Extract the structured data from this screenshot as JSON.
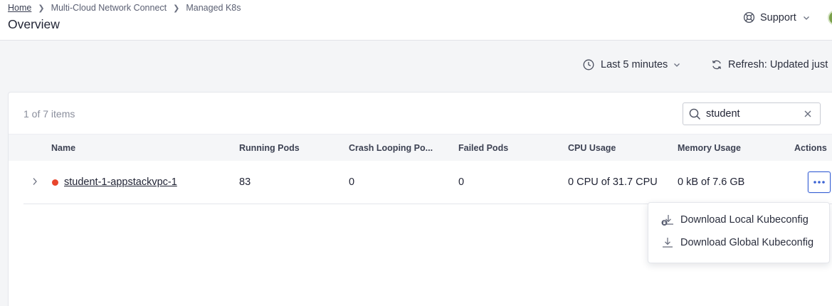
{
  "breadcrumb": {
    "items": [
      "Home",
      "Multi-Cloud Network Connect",
      "Managed K8s"
    ]
  },
  "header": {
    "title": "Overview",
    "support_label": "Support",
    "support_icon": "lifebuoy-icon"
  },
  "toolbar": {
    "time_range_label": "Last 5 minutes",
    "refresh_label": "Refresh: Updated just"
  },
  "table": {
    "item_count": "1 of 7 items",
    "search": {
      "value": "student",
      "placeholder": ""
    },
    "columns": [
      "Name",
      "Running Pods",
      "Crash Looping Po...",
      "Failed Pods",
      "CPU Usage",
      "Memory Usage",
      "Actions"
    ],
    "rows": [
      {
        "name": "student-1-appstackvpc-1",
        "status_color": "#e8452c",
        "running_pods": "83",
        "crash_looping_pods": "0",
        "failed_pods": "0",
        "cpu_usage": "0 CPU of 31.7 CPU",
        "memory_usage": "0 kB of 7.6 GB"
      }
    ]
  },
  "actions_menu": {
    "items": [
      {
        "label": "Download Local Kubeconfig",
        "icon": "download-lock-icon"
      },
      {
        "label": "Download Global Kubeconfig",
        "icon": "download-icon"
      }
    ]
  },
  "colors": {
    "accent": "#3a62d4",
    "status_error": "#e8452c"
  }
}
